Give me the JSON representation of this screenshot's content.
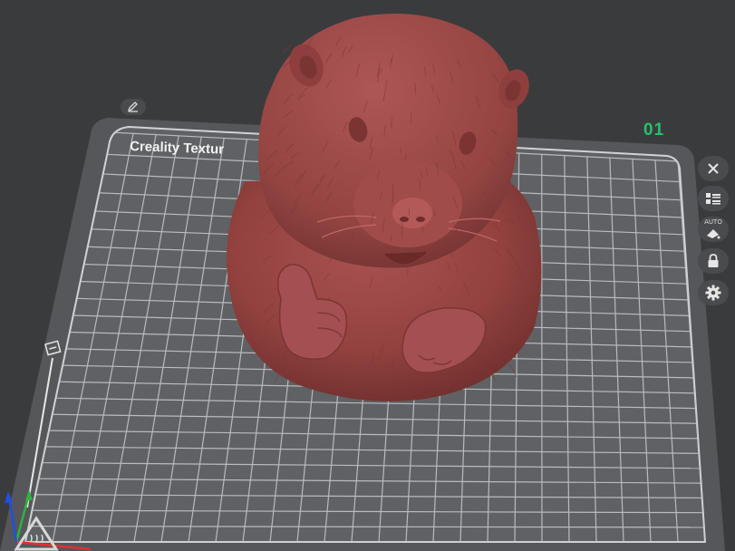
{
  "build_plate": {
    "label": "Creality Textur",
    "number": "01"
  },
  "side_toolbar": [
    {
      "name": "close-icon",
      "label": ""
    },
    {
      "name": "list-icon",
      "label": ""
    },
    {
      "name": "auto-orient-icon",
      "label": "AUTO"
    },
    {
      "name": "lock-icon",
      "label": ""
    },
    {
      "name": "gear-icon",
      "label": ""
    }
  ],
  "colors": {
    "background": "#3a3b3d",
    "plate": "#5a5c60",
    "grid": "#c8cacd",
    "model": "#9b4848",
    "plate_number": "#27c06a",
    "axis_x": "#e03030",
    "axis_y": "#30b040",
    "axis_z": "#2050e0"
  },
  "model": {
    "name": "marmot-thumbs-up"
  }
}
